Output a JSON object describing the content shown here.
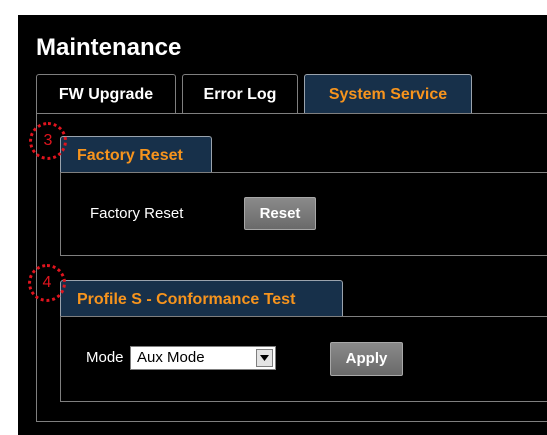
{
  "page": {
    "title": "Maintenance"
  },
  "tabs": [
    {
      "label": "FW Upgrade",
      "active": false
    },
    {
      "label": "Error Log",
      "active": false
    },
    {
      "label": "System Service",
      "active": true
    }
  ],
  "sections": {
    "factory_reset": {
      "header": "Factory Reset",
      "field_label": "Factory Reset",
      "button_label": "Reset"
    },
    "profile_s": {
      "header": "Profile S - Conformance Test",
      "mode_label": "Mode",
      "mode_value": "Aux Mode",
      "button_label": "Apply"
    }
  },
  "annotations": {
    "marker_3": "3",
    "marker_4": "4"
  },
  "colors": {
    "background": "#000000",
    "accent": "#f7941d",
    "active_tab_bg": "#17304a",
    "annotation": "#e0141e",
    "button": "#7a7a7a"
  }
}
